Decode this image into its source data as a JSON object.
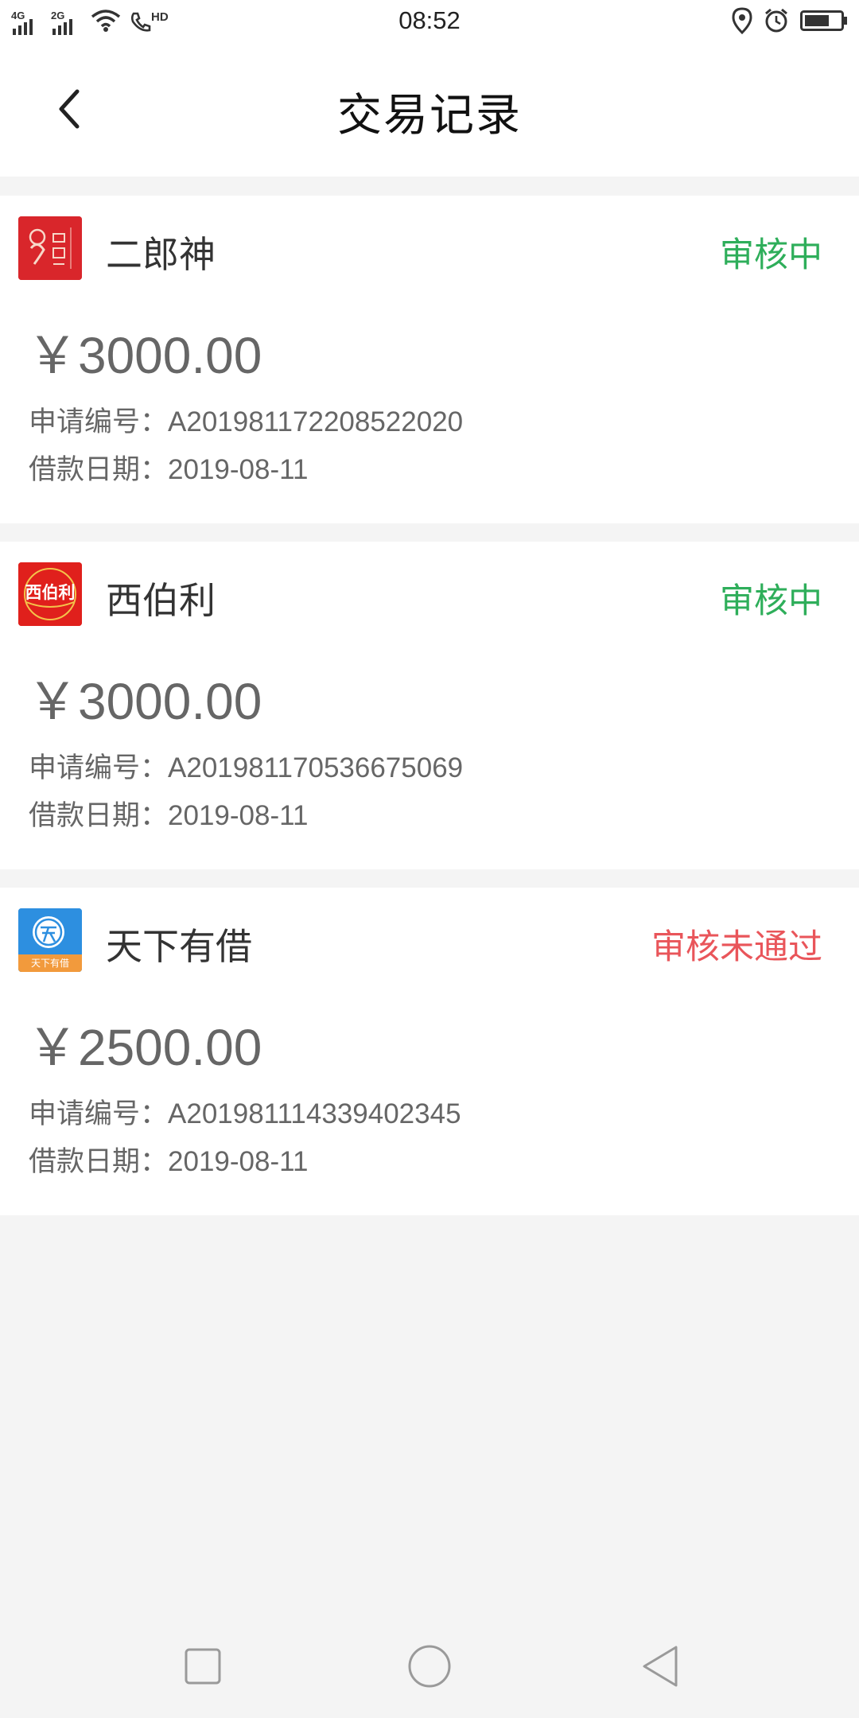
{
  "status_bar": {
    "network_1": "4G",
    "network_2": "2G",
    "hd": "HD",
    "time": "08:52"
  },
  "header": {
    "title": "交易记录",
    "back_icon": "chevron-left-icon"
  },
  "records": [
    {
      "name": "二郎神",
      "status": "审核中",
      "status_color": "#2eae5a",
      "amount": "￥3000.00",
      "app_no_label": "申请编号：",
      "app_no": "A201981172208522020",
      "date_label": "借款日期：",
      "date": "2019-08-11",
      "logo_color": "#d9262b"
    },
    {
      "name": "西伯利",
      "status": "审核中",
      "status_color": "#2eae5a",
      "amount": "￥3000.00",
      "app_no_label": "申请编号：",
      "app_no": "A201981170536675069",
      "date_label": "借款日期：",
      "date": "2019-08-11",
      "logo_color": "#e0201c",
      "logo_text": "西伯利"
    },
    {
      "name": "天下有借",
      "status": "审核未通过",
      "status_color": "#e9555a",
      "amount": "￥2500.00",
      "app_no_label": "申请编号：",
      "app_no": "A201981114339402345",
      "date_label": "借款日期：",
      "date": "2019-08-11",
      "logo_color": "#2d8fe0",
      "logo_text": "天下有借"
    }
  ],
  "nav": {
    "recent": "square-icon",
    "home": "circle-icon",
    "back": "triangle-back-icon"
  }
}
